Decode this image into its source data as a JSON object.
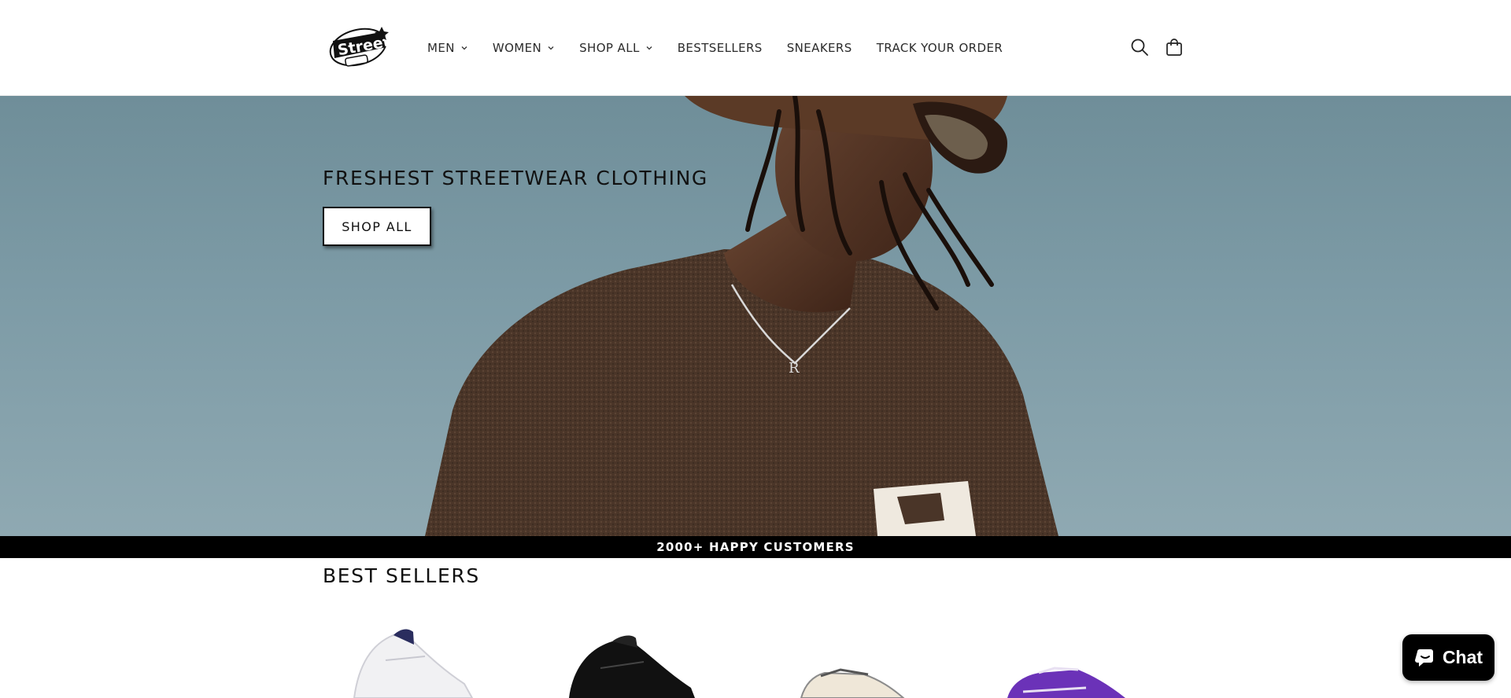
{
  "header": {
    "logo_alt": "StreetLand",
    "nav": [
      {
        "label": "MEN",
        "has_dropdown": true
      },
      {
        "label": "WOMEN",
        "has_dropdown": true
      },
      {
        "label": "SHOP ALL",
        "has_dropdown": true
      },
      {
        "label": "BESTSELLERS",
        "has_dropdown": false
      },
      {
        "label": "SNEAKERS",
        "has_dropdown": false
      },
      {
        "label": "TRACK YOUR ORDER",
        "has_dropdown": false
      }
    ],
    "icons": {
      "search": "search-icon",
      "cart": "cart-icon"
    }
  },
  "hero": {
    "title": "FRESHEST STREETWEAR CLOTHING",
    "button_label": "SHOP ALL"
  },
  "announcement": {
    "text": "2000+ HAPPY CUSTOMERS"
  },
  "best_sellers": {
    "title": "BEST SELLERS",
    "products": [
      {
        "image": "white-purple-sneaker"
      },
      {
        "image": "black-sneaker"
      },
      {
        "image": "cream-grey-sneaker"
      },
      {
        "image": "purple-sneaker"
      }
    ]
  },
  "chat": {
    "label": "Chat"
  },
  "colors": {
    "sky": "#7d9ba6",
    "announcement_bg": "#000000",
    "sweater": "#4a3528",
    "chat_bg": "#000000"
  }
}
